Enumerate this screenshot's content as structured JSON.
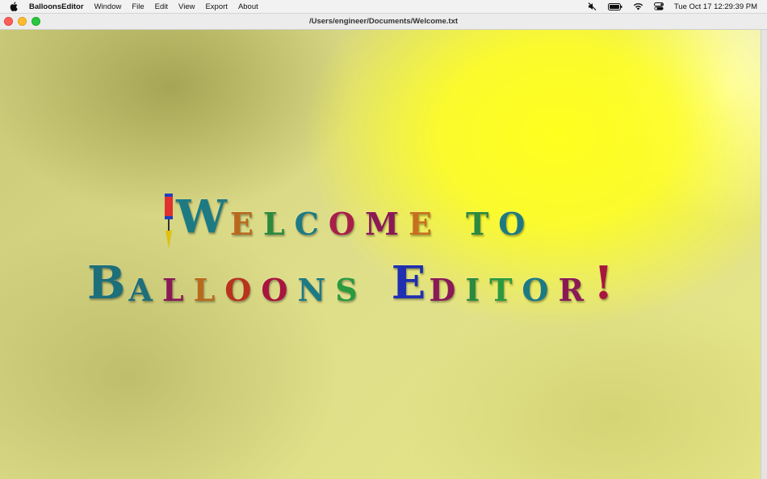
{
  "menubar": {
    "app_name": "BalloonsEditor",
    "items": [
      "Window",
      "File",
      "Edit",
      "View",
      "Export",
      "About"
    ],
    "clock": "Tue Oct 17  12:29:39 PM"
  },
  "window": {
    "title": "/Users/engineer/Documents/Welcome.txt"
  },
  "document": {
    "line1": [
      {
        "ch": "W",
        "color": "#1d7a82",
        "size": "big"
      },
      {
        "ch": "E",
        "color": "#b8691c",
        "size": "sm"
      },
      {
        "ch": "L",
        "color": "#2a8a3e",
        "size": "sm"
      },
      {
        "ch": "C",
        "color": "#1d7a82",
        "size": "sm"
      },
      {
        "ch": "O",
        "color": "#a81f47",
        "size": "sm"
      },
      {
        "ch": "M",
        "color": "#8a1a55",
        "size": "sm"
      },
      {
        "ch": "E",
        "color": "#c8701e",
        "size": "sm"
      },
      {
        "ch": " ",
        "color": "",
        "size": "gap"
      },
      {
        "ch": "T",
        "color": "#2a8a3e",
        "size": "sm"
      },
      {
        "ch": "O",
        "color": "#1d7a82",
        "size": "sm"
      }
    ],
    "line2": [
      {
        "ch": "B",
        "color": "#1d6f7a",
        "size": "big"
      },
      {
        "ch": "A",
        "color": "#1d6f7a",
        "size": "sm"
      },
      {
        "ch": "L",
        "color": "#8a1a55",
        "size": "sm"
      },
      {
        "ch": "L",
        "color": "#b86a1c",
        "size": "sm"
      },
      {
        "ch": "O",
        "color": "#b8331c",
        "size": "sm"
      },
      {
        "ch": "O",
        "color": "#a8153d",
        "size": "sm"
      },
      {
        "ch": "N",
        "color": "#1d7a82",
        "size": "sm"
      },
      {
        "ch": "S",
        "color": "#2a9a3e",
        "size": "sm"
      },
      {
        "ch": " ",
        "color": "",
        "size": "gap"
      },
      {
        "ch": "E",
        "color": "#1f2fb0",
        "size": "big"
      },
      {
        "ch": "D",
        "color": "#8a1a55",
        "size": "sm"
      },
      {
        "ch": "I",
        "color": "#2a8a3e",
        "size": "sm"
      },
      {
        "ch": "T",
        "color": "#2a9a3e",
        "size": "sm"
      },
      {
        "ch": "O",
        "color": "#1d7a82",
        "size": "sm"
      },
      {
        "ch": "R",
        "color": "#8a1a55",
        "size": "sm"
      },
      {
        "ch": "!",
        "color": "#a8153d",
        "size": "big"
      }
    ]
  },
  "colors": {
    "accent_yellow": "#ffff1e",
    "pump_red": "#e03030",
    "pump_blue": "#2040c0",
    "pump_tip": "#e0c010"
  }
}
